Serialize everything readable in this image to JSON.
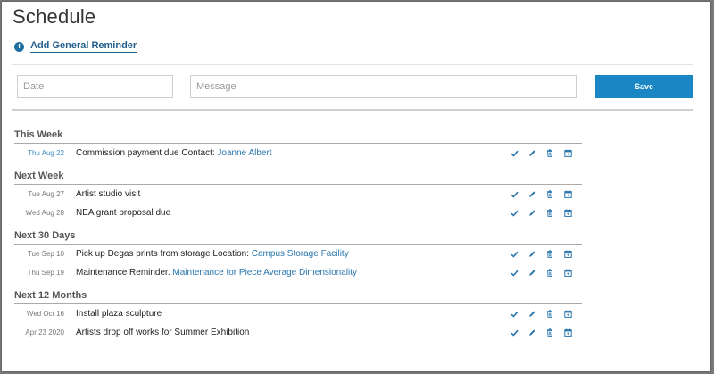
{
  "page": {
    "title": "Schedule"
  },
  "add_reminder": {
    "label": "Add General Reminder",
    "icon": "plus-circle-icon"
  },
  "form": {
    "date_placeholder": "Date",
    "message_placeholder": "Message",
    "save_label": "Save"
  },
  "colors": {
    "accent": "#1a87c4",
    "link": "#2a76ad",
    "heading": "#555555"
  },
  "sections": [
    {
      "header": "This Week",
      "rows": [
        {
          "date": "Thu Aug 22",
          "text": "Commission payment due Contact: ",
          "link": "Joanne Albert"
        }
      ]
    },
    {
      "header": "Next Week",
      "rows": [
        {
          "date": "Tue Aug 27",
          "text": "Artist studio visit",
          "link": ""
        },
        {
          "date": "Wed Aug 28",
          "text": "NEA grant proposal due",
          "link": ""
        }
      ]
    },
    {
      "header": "Next 30 Days",
      "rows": [
        {
          "date": "Tue Sep 10",
          "text": "Pick up Degas prints from storage Location: ",
          "link": "Campus Storage Facility"
        },
        {
          "date": "Thu Sep 19",
          "text": "Maintenance Reminder. ",
          "link": "Maintenance for Piece Average Dimensionality"
        }
      ]
    },
    {
      "header": "Next 12 Months",
      "rows": [
        {
          "date": "Wed Oct 16",
          "text": "Install plaza sculpture",
          "link": ""
        },
        {
          "date": "Apr 23 2020",
          "text": "Artists drop off works for Summer Exhibition",
          "link": ""
        }
      ]
    }
  ],
  "row_actions": [
    "check-icon",
    "pencil-icon",
    "trash-icon",
    "calendar-icon"
  ]
}
